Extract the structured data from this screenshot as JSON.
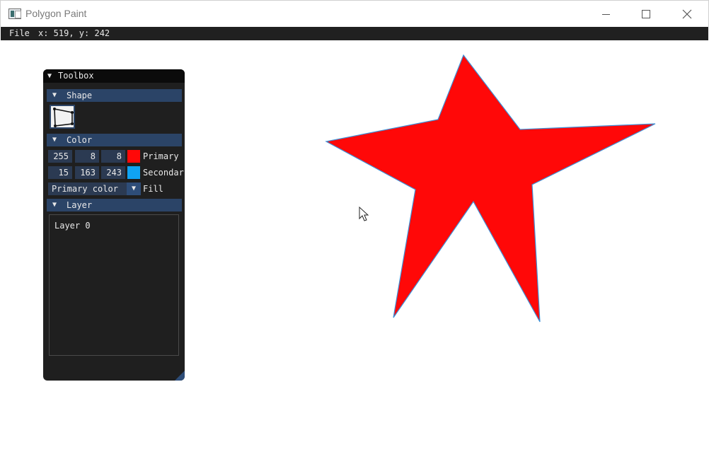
{
  "window": {
    "title": "Polygon Paint"
  },
  "menubar": {
    "file_label": "File",
    "coords_text": "x: 519, y: 242"
  },
  "canvas": {
    "star_fill": "#ff0808",
    "star_outline": "#3d8fd6"
  },
  "toolbox": {
    "title": "Toolbox",
    "shape_header": "Shape",
    "color_header": "Color",
    "layer_header": "Layer",
    "primary": {
      "r": "255",
      "g": "8",
      "b": "8",
      "hex": "#ff0808",
      "label": "Primary"
    },
    "secondary": {
      "r": "15",
      "g": "163",
      "b": "243",
      "hex": "#0fa3f3",
      "label": "Secondar"
    },
    "fill_combo_value": "Primary color",
    "fill_label": "Fill",
    "layers": [
      {
        "name": "Layer 0"
      }
    ]
  },
  "colors": {
    "header_bg": "#2b4467",
    "frame_bg": "#2b3a52",
    "window_bg": "#1f1f1f",
    "menubar_bg": "#202020"
  }
}
